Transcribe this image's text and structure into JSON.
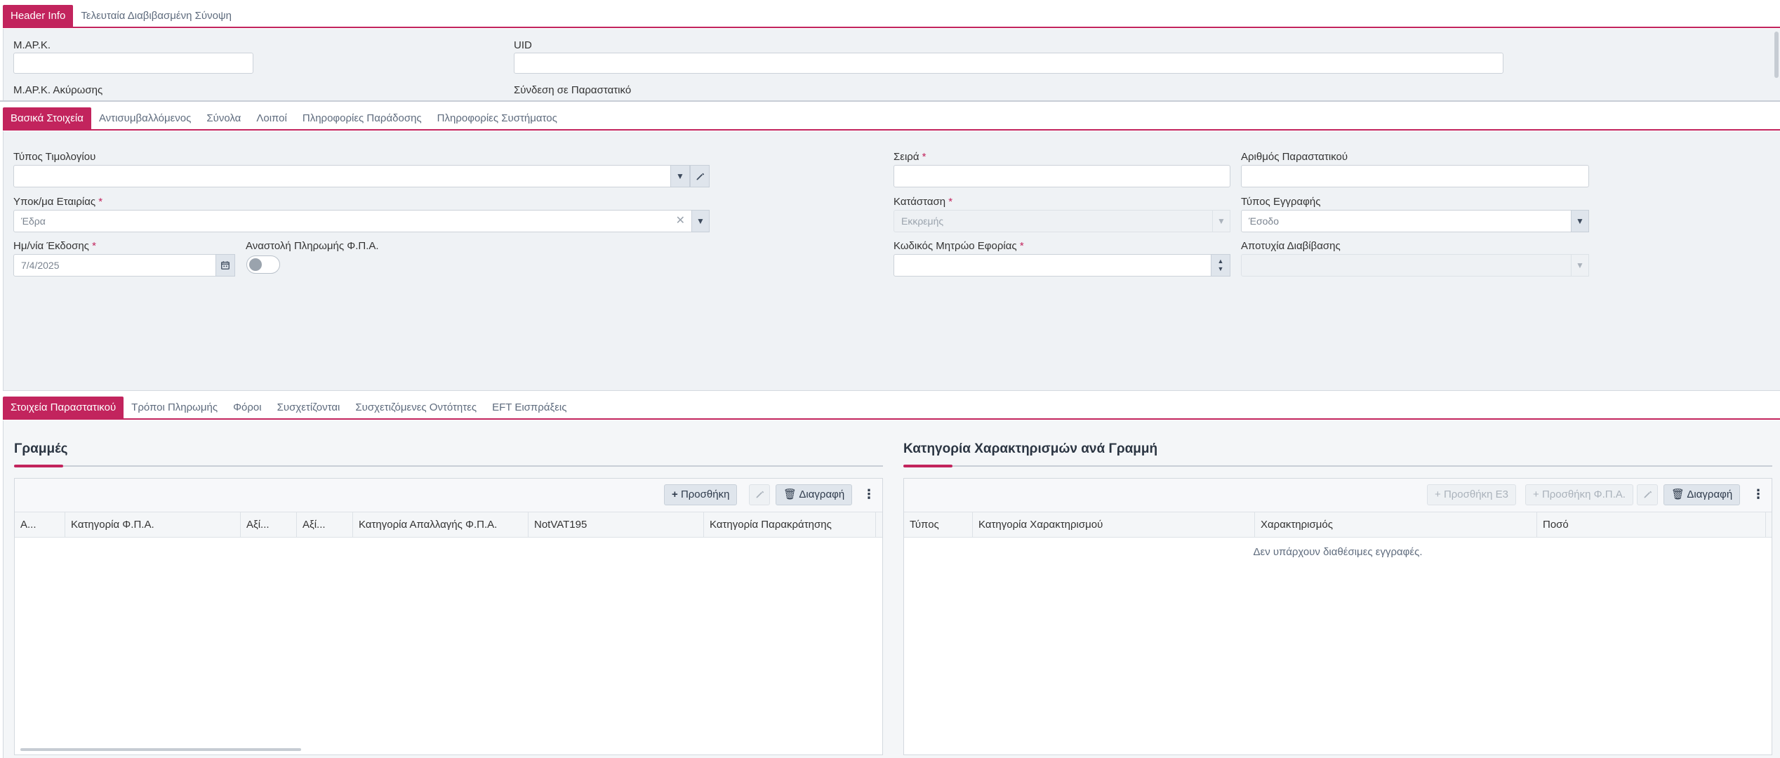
{
  "header_tabs": [
    {
      "label": "Header Info"
    },
    {
      "label": "Τελευταία Διαβιβασμένη Σύνοψη"
    }
  ],
  "header_info": {
    "mark_label": "Μ.ΑΡ.Κ.",
    "mark_value": "",
    "uid_label": "UID",
    "uid_value": "",
    "mark_cancel_label": "Μ.ΑΡ.Κ. Ακύρωσης",
    "link_label": "Σύνδεση σε Παραστατικό"
  },
  "main_tabs": [
    {
      "label": "Βασικά Στοιχεία"
    },
    {
      "label": "Αντισυμβαλλόμενος"
    },
    {
      "label": "Σύνολα"
    },
    {
      "label": "Λοιποί"
    },
    {
      "label": "Πληροφορίες Παράδοσης"
    },
    {
      "label": "Πληροφορίες Συστήματος"
    }
  ],
  "basic": {
    "invoice_type_label": "Τύπος Τιμολογίου",
    "invoice_type_value": "",
    "series_label": "Σειρά",
    "series_value": "",
    "doc_number_label": "Αριθμός Παραστατικού",
    "doc_number_value": "",
    "branch_label": "Υποκ/μα Εταιρίας",
    "branch_value": "Έδρα",
    "status_label": "Κατάσταση",
    "status_value": "Εκκρεμής",
    "entry_type_label": "Τύπος Εγγραφής",
    "entry_type_value": "Έσοδο",
    "issue_date_label": "Ημ/νία Έκδοσης",
    "issue_date_value": "7/4/2025",
    "vat_suspend_label": "Αναστολή Πληρωμής Φ.Π.Α.",
    "vat_suspend_on": false,
    "tax_registry_label": "Κωδικός Μητρώο Εφορίας",
    "tax_registry_value": "",
    "transmission_fail_label": "Αποτυχία Διαβίβασης",
    "transmission_fail_value": "",
    "required_mark": "*"
  },
  "detail_tabs": [
    {
      "label": "Στοιχεία Παραστατικού"
    },
    {
      "label": "Τρόποι Πληρωμής"
    },
    {
      "label": "Φόροι"
    },
    {
      "label": "Συσχετίζονται"
    },
    {
      "label": "Συσχετιζόμενες Οντότητες"
    },
    {
      "label": "EFT Εισπράξεις"
    }
  ],
  "lines": {
    "title": "Γραμμές",
    "add_label": "Προσθήκη",
    "delete_label": "Διαγραφή",
    "columns": [
      "Α...",
      "Κατηγορία Φ.Π.Α.",
      "Αξί...",
      "Αξί...",
      "Κατηγορία Απαλλαγής Φ.Π.Α.",
      "NotVAT195",
      "Κατηγορία Παρακράτησης"
    ]
  },
  "classifications": {
    "title": "Κατηγορία Χαρακτηρισμών ανά Γραμμή",
    "add_e3_label": "Προσθήκη Ε3",
    "add_vat_label": "Προσθήκη Φ.Π.Α.",
    "delete_label": "Διαγραφή",
    "columns": [
      "Τύπος",
      "Κατηγορία Χαρακτηρισμού",
      "Χαρακτηρισμός",
      "Ποσό"
    ],
    "empty_text": "Δεν υπάρχουν διαθέσιμες εγγραφές."
  },
  "colors": {
    "accent": "#c2245d",
    "panel": "#eff2f5"
  }
}
